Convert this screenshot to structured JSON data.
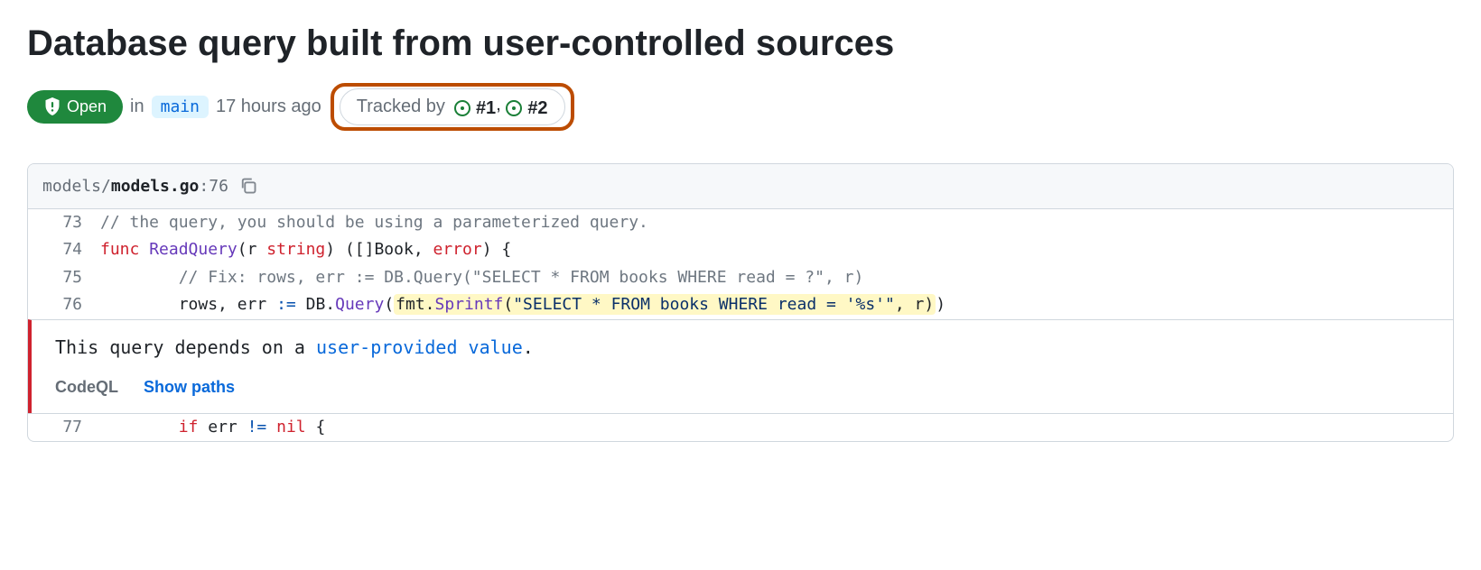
{
  "title": "Database query built from user-controlled sources",
  "state": {
    "label": "Open"
  },
  "meta": {
    "in_label": "in",
    "branch": "main",
    "time": "17 hours ago"
  },
  "tracked": {
    "label": "Tracked by",
    "issues": [
      "#1",
      "#2"
    ]
  },
  "file": {
    "dir": "models/",
    "name": "models.go",
    "sep": ":",
    "line": "76"
  },
  "code": {
    "lines": [
      {
        "n": "73",
        "segments": [
          {
            "t": "comment",
            "v": "// the query, you should be using a parameterized query."
          }
        ]
      },
      {
        "n": "74",
        "segments": [
          {
            "t": "kw",
            "v": "func "
          },
          {
            "t": "func",
            "v": "ReadQuery"
          },
          {
            "t": "plain",
            "v": "(r "
          },
          {
            "t": "kw",
            "v": "string"
          },
          {
            "t": "plain",
            "v": ") ([]Book, "
          },
          {
            "t": "kw",
            "v": "error"
          },
          {
            "t": "plain",
            "v": ") {"
          }
        ]
      },
      {
        "n": "75",
        "segments": [
          {
            "t": "plain",
            "v": "        "
          },
          {
            "t": "comment",
            "v": "// Fix: rows, err := DB.Query(\"SELECT * FROM books WHERE read = ?\", r)"
          }
        ]
      },
      {
        "n": "76",
        "segments": [
          {
            "t": "plain",
            "v": "        rows, err "
          },
          {
            "t": "op",
            "v": ":="
          },
          {
            "t": "plain",
            "v": " DB."
          },
          {
            "t": "func",
            "v": "Query"
          },
          {
            "t": "plain",
            "v": "("
          },
          {
            "t": "hl-open",
            "v": ""
          },
          {
            "t": "plain",
            "v": "fmt."
          },
          {
            "t": "func",
            "v": "Sprintf"
          },
          {
            "t": "plain",
            "v": "("
          },
          {
            "t": "str",
            "v": "\"SELECT * FROM books WHERE read = '%s'\""
          },
          {
            "t": "plain",
            "v": ", r)"
          },
          {
            "t": "hl-close",
            "v": ""
          },
          {
            "t": "plain",
            "v": ")"
          }
        ]
      }
    ],
    "bottom_line": {
      "n": "77",
      "segments": [
        {
          "t": "plain",
          "v": "        "
        },
        {
          "t": "kw",
          "v": "if"
        },
        {
          "t": "plain",
          "v": " err "
        },
        {
          "t": "op",
          "v": "!="
        },
        {
          "t": "plain",
          "v": " "
        },
        {
          "t": "kw",
          "v": "nil"
        },
        {
          "t": "plain",
          "v": " {"
        }
      ]
    }
  },
  "alert": {
    "prefix": "This query depends on a ",
    "link": "user-provided value",
    "suffix": "."
  },
  "actions": {
    "codeql": "CodeQL",
    "show_paths": "Show paths"
  }
}
